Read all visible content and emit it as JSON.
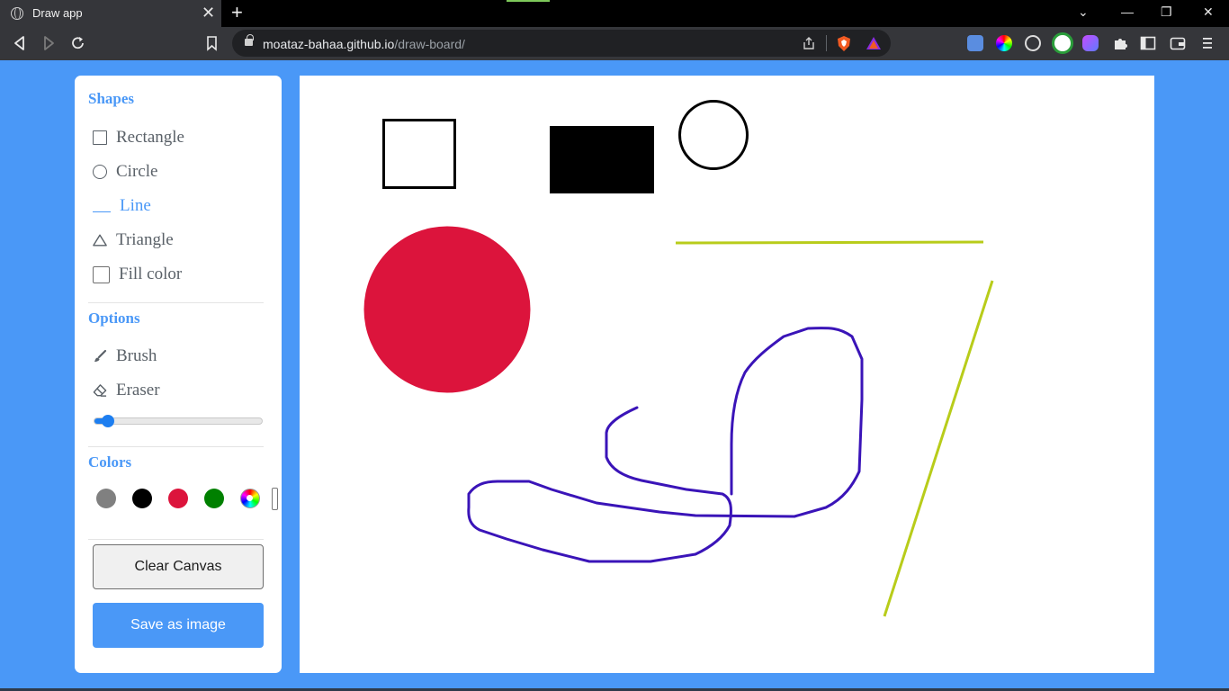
{
  "browser": {
    "tab_title": "Draw app",
    "tab_close": "✕",
    "new_tab": "+",
    "url_domain": "moataz-bahaa.github.io",
    "url_path": "/draw-board/"
  },
  "sidebar": {
    "shapes_title": "Shapes",
    "shapes": [
      {
        "label": "Rectangle",
        "icon": "square-outline-icon"
      },
      {
        "label": "Circle",
        "icon": "circle-outline-icon"
      },
      {
        "label": "Line",
        "icon": "line-icon",
        "active": true
      },
      {
        "label": "Triangle",
        "icon": "triangle-outline-icon"
      }
    ],
    "fill_color_label": "Fill color",
    "fill_color_checked": false,
    "options_title": "Options",
    "brush_label": "Brush",
    "eraser_label": "Eraser",
    "brush_size_fraction": 0.08,
    "colors_title": "Colors",
    "swatches": [
      "#808080",
      "#000000",
      "#dc143c",
      "#008000"
    ],
    "clear_label": "Clear Canvas",
    "save_label": "Save as image"
  },
  "colors": {
    "accent": "#4a98f7",
    "red_fill": "#dc143c",
    "yellow_green_line": "#b8cc1a",
    "purple_stroke": "#3a14b8"
  }
}
